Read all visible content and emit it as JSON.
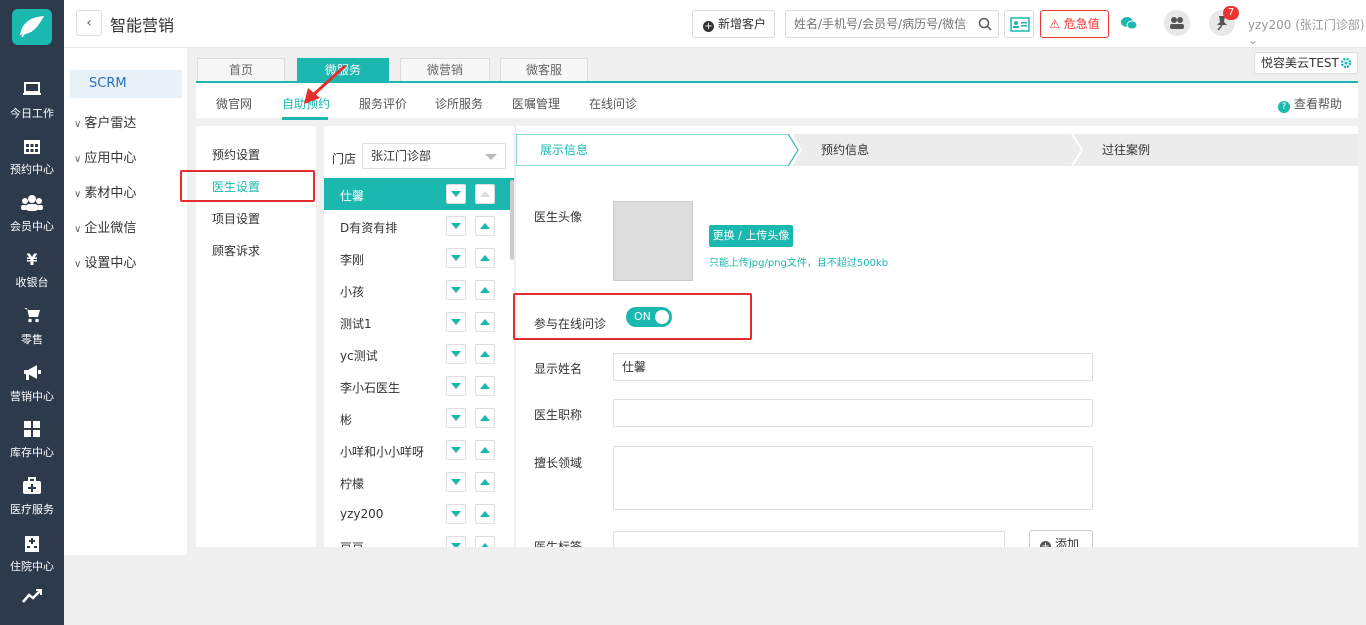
{
  "header": {
    "title": "智能营销",
    "new_customer": "新增客户",
    "search_placeholder": "姓名/手机号/会员号/病历号/微信号",
    "urgent": "危急值",
    "badge_count": "7",
    "user": "yzy200 (张江门诊部)"
  },
  "leftnav": [
    {
      "label": "今日工作",
      "icon": "laptop-icon"
    },
    {
      "label": "预约中心",
      "icon": "calendar-icon"
    },
    {
      "label": "会员中心",
      "icon": "users-icon"
    },
    {
      "label": "收银台",
      "icon": "yen-icon"
    },
    {
      "label": "零售",
      "icon": "cart-icon"
    },
    {
      "label": "营销中心",
      "icon": "megaphone-icon"
    },
    {
      "label": "库存中心",
      "icon": "grid-icon"
    },
    {
      "label": "医疗服务",
      "icon": "medkit-icon"
    },
    {
      "label": "住院中心",
      "icon": "hospital-icon"
    }
  ],
  "secondary": {
    "scrm": "SCRM",
    "items": [
      "客户雷达",
      "应用中心",
      "素材中心",
      "企业微信",
      "设置中心"
    ]
  },
  "top_tabs": [
    "首页",
    "微服务",
    "微营销",
    "微客服"
  ],
  "store_tag": "悦容美云TEST",
  "sub_tabs": [
    "微官网",
    "自助预约",
    "服务评价",
    "诊所服务",
    "医嘱管理",
    "在线问诊"
  ],
  "help": "查看帮助",
  "settings_menu": [
    "预约设置",
    "医生设置",
    "项目设置",
    "顾客诉求"
  ],
  "store": {
    "label": "门店",
    "value": "张江门诊部"
  },
  "doctors": [
    "仕馨",
    "D有资有排",
    "李刚",
    "小孩",
    "测试1",
    "yc测试",
    "李小石医生",
    "彬",
    "小咩和小小咩呀",
    "柠檬",
    "yzy200",
    "豆豆"
  ],
  "steps": [
    "展示信息",
    "预约信息",
    "过往案例"
  ],
  "form": {
    "avatar_label": "医生头像",
    "upload_label": "更换 / 上传头像",
    "upload_hint": "只能上传jpg/png文件，且不超过500kb",
    "online_label": "参与在线问诊",
    "online_toggle": "ON",
    "name_label": "显示姓名",
    "name_value": "仕馨",
    "title_label": "医生职称",
    "specialty_label": "擅长领域",
    "tag_label": "医生标签",
    "add_label": "添加"
  },
  "colors": {
    "accent": "#1bb8b0",
    "sidebar": "#2d3a4b",
    "annotation": "#e52d2d"
  }
}
